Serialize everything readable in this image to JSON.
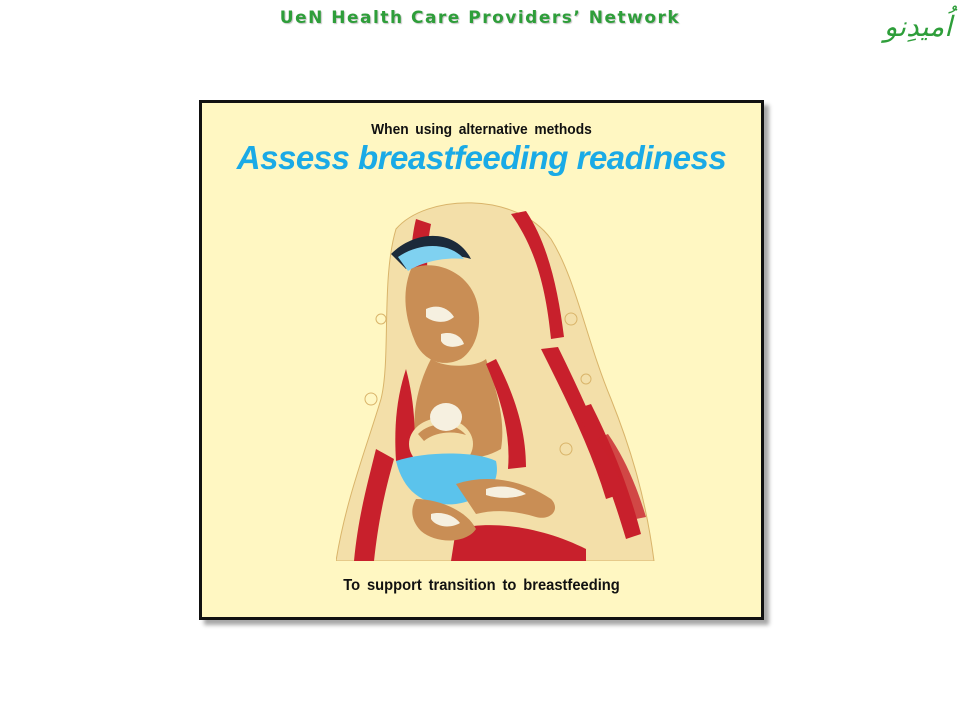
{
  "header": {
    "title": "UeN Health Care Providers’ Network",
    "logo_text": "اُمیدِنو"
  },
  "panel": {
    "subtitle": "When using alternative methods",
    "headline": "Assess breastfeeding readiness",
    "footer": "To support transition to breastfeeding"
  },
  "colors": {
    "header_green": "#2e9e3a",
    "headline_blue": "#1aaae6",
    "panel_background": "#fff7c2",
    "shawl_red": "#c8202c"
  }
}
